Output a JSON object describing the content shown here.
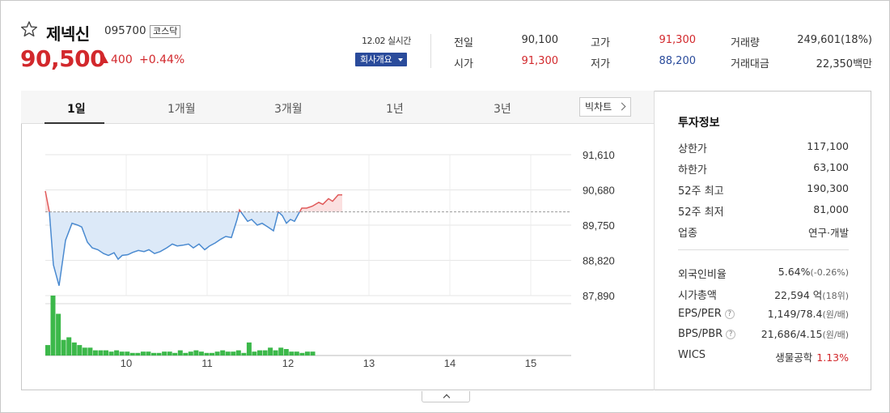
{
  "stock": {
    "name": "제넥신",
    "code": "095700",
    "market": "코스닥",
    "price": "90,500",
    "change": "400",
    "change_pct": "+0.44%",
    "realtime": "12.02 실시간",
    "company_button": "회사개요"
  },
  "summary": {
    "prev_label": "전일",
    "prev_value": "90,100",
    "high_label": "고가",
    "high_value": "91,300",
    "volume_label": "거래량",
    "volume_value": "249,601(18%)",
    "open_label": "시가",
    "open_value": "91,300",
    "low_label": "저가",
    "low_value": "88,200",
    "amount_label": "거래대금",
    "amount_value": "22,350백만"
  },
  "tabs": [
    "1일",
    "1개월",
    "3개월",
    "1년",
    "3년"
  ],
  "bigchart_label": "빅차트",
  "invest": {
    "title": "투자정보",
    "rows": [
      {
        "label": "상한가",
        "value": "117,100"
      },
      {
        "label": "하한가",
        "value": "63,100"
      },
      {
        "label": "52주 최고",
        "value": "190,300"
      },
      {
        "label": "52주 최저",
        "value": "81,000"
      },
      {
        "label": "업종",
        "value": "연구·개발"
      }
    ],
    "rows2": [
      {
        "label": "외국인비율",
        "value": "5.64%",
        "sub": "(-0.26%)"
      },
      {
        "label": "시가총액",
        "value": "22,594 억",
        "sub": "(18위)"
      },
      {
        "label": "EPS/PER",
        "value": "1,149/78.4",
        "sub": "(원/배)"
      },
      {
        "label": "BPS/PBR",
        "value": "21,686/4.15",
        "sub": "(원/배)"
      },
      {
        "label": "WICS",
        "value": "생물공학",
        "sub": "1.13%"
      }
    ]
  },
  "colors": {
    "up": "#d2282c",
    "down": "#2a4b9b",
    "line": "#4a8ad0",
    "fill": "#dce9f8",
    "volume": "#3cb84a"
  },
  "chart_data": {
    "type": "line",
    "title": "",
    "prev_close": 90100,
    "ylim": [
      87890,
      91610
    ],
    "yticks": [
      "91,610",
      "90,680",
      "89,750",
      "88,820",
      "87,890"
    ],
    "xticks": [
      "10",
      "11",
      "12",
      "13",
      "14",
      "15"
    ],
    "x_range_hours": [
      9,
      15.5
    ],
    "series": [
      {
        "values": [
          [
            9.0,
            90650
          ],
          [
            9.05,
            90100
          ],
          [
            9.1,
            88700
          ],
          [
            9.17,
            88150
          ],
          [
            9.25,
            89350
          ],
          [
            9.33,
            89800
          ],
          [
            9.4,
            89750
          ],
          [
            9.45,
            89700
          ],
          [
            9.52,
            89300
          ],
          [
            9.58,
            89150
          ],
          [
            9.65,
            89100
          ],
          [
            9.72,
            89000
          ],
          [
            9.78,
            88950
          ],
          [
            9.85,
            89020
          ],
          [
            9.9,
            88850
          ],
          [
            9.95,
            88950
          ],
          [
            10.02,
            88970
          ],
          [
            10.08,
            89030
          ],
          [
            10.15,
            89080
          ],
          [
            10.22,
            89050
          ],
          [
            10.28,
            89100
          ],
          [
            10.35,
            89000
          ],
          [
            10.42,
            89050
          ],
          [
            10.5,
            89150
          ],
          [
            10.57,
            89250
          ],
          [
            10.63,
            89200
          ],
          [
            10.7,
            89220
          ],
          [
            10.77,
            89250
          ],
          [
            10.83,
            89150
          ],
          [
            10.9,
            89250
          ],
          [
            10.97,
            89100
          ],
          [
            11.03,
            89200
          ],
          [
            11.1,
            89280
          ],
          [
            11.17,
            89380
          ],
          [
            11.23,
            89450
          ],
          [
            11.3,
            89420
          ],
          [
            11.37,
            89900
          ],
          [
            11.4,
            90150
          ],
          [
            11.45,
            90000
          ],
          [
            11.5,
            89850
          ],
          [
            11.55,
            89900
          ],
          [
            11.62,
            89750
          ],
          [
            11.68,
            89800
          ],
          [
            11.75,
            89700
          ],
          [
            11.82,
            89600
          ],
          [
            11.88,
            90100
          ],
          [
            11.93,
            90000
          ],
          [
            11.98,
            89800
          ],
          [
            12.03,
            89900
          ],
          [
            12.08,
            89850
          ],
          [
            12.13,
            90050
          ],
          [
            12.17,
            90200
          ],
          [
            12.23,
            90200
          ],
          [
            12.3,
            90250
          ],
          [
            12.38,
            90350
          ],
          [
            12.43,
            90300
          ],
          [
            12.5,
            90450
          ],
          [
            12.55,
            90380
          ],
          [
            12.62,
            90550
          ],
          [
            12.67,
            90550
          ]
        ]
      }
    ],
    "volume": [
      4,
      23,
      16,
      6,
      7,
      5,
      4,
      3,
      3,
      2,
      2,
      2,
      1.5,
      2,
      1.5,
      1.5,
      1,
      1,
      1.5,
      1.5,
      1,
      1,
      1.5,
      1.5,
      1,
      2,
      1,
      1.5,
      2,
      1.5,
      1,
      1,
      1.5,
      2,
      1.5,
      1.5,
      2,
      1,
      5,
      1.5,
      2,
      2,
      3,
      2,
      3,
      2.5,
      1.5,
      1.5,
      1,
      1.5,
      1.5
    ]
  }
}
